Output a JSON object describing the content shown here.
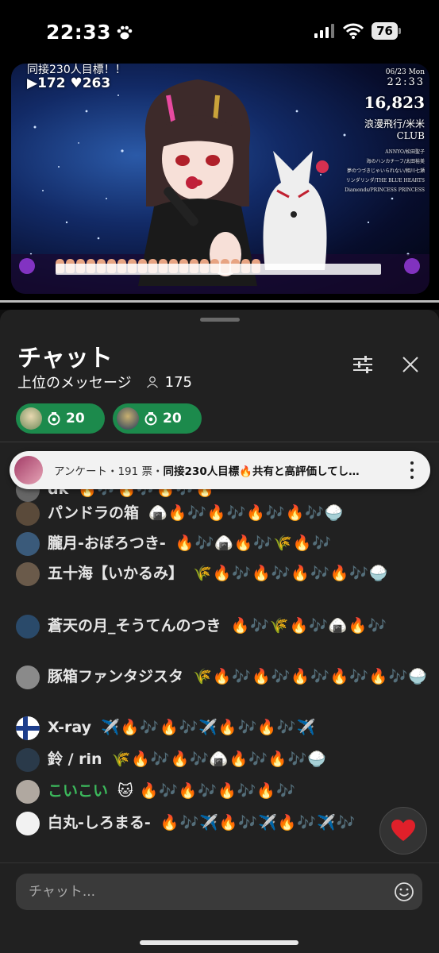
{
  "status_bar": {
    "time": "22:33",
    "battery": "76"
  },
  "video": {
    "overlay_goal": "同接230人目標！！",
    "overlay_views": "▶172",
    "overlay_likes": "♥263",
    "overlay_date": "06/23 Mon",
    "overlay_clock": "22:33",
    "overlay_count": "16,823",
    "overlay_song": "浪漫飛行/米米CLUB",
    "overlay_list": [
      "ANNYO/松田聖子",
      "海のハンカチーフ/太田裕美",
      "夢のつづきじゃいられない/相川七瀬",
      "リンダリンダ/THE BLUE HEARTS",
      "Diamonds/PRINCESS PRINCESS"
    ]
  },
  "chat": {
    "title": "チャット",
    "subtitle": "上位のメッセージ",
    "viewer_count": "175",
    "badges": [
      {
        "value": "20"
      },
      {
        "value": "20"
      }
    ],
    "poll": {
      "label": "アンケート・191 票・",
      "text": "同接230人目標🔥共有と高評価してし…"
    },
    "messages": [
      {
        "author": "dk",
        "text": "🔥🎶🔥🎶🔥🎶🔥",
        "avatar": "#666666"
      },
      {
        "author": "パンドラの箱",
        "text": "🍙🔥🎶🔥🎶🔥🎶🔥🎶🍚",
        "avatar": "#5a4a3a"
      },
      {
        "author": "朧月-おぼろつき-",
        "text": "🔥🎶🍙🔥🎶🌾🔥🎶",
        "avatar": "#3a5a7a"
      },
      {
        "author": "五十海【いかるみ】",
        "text": "🌾🔥🎶🔥🎶🔥🎶🔥🎶🍚",
        "avatar": "#6a5a4a"
      },
      {
        "author": "蒼天の月_そうてんのつき",
        "text": "🔥🎶🌾🔥🎶🍙🔥🎶",
        "avatar": "#2a4a6a"
      },
      {
        "author": "豚箱ファンタジスタ",
        "text": "🌾🔥🎶🔥🎶🔥🎶🔥🎶🔥🎶🍚",
        "avatar": "#8a8a8a"
      },
      {
        "author": "X-ray",
        "text": "✈️🔥🎶🔥🎶✈️🔥🎶🔥🎶✈️",
        "avatar": "#ffffff"
      },
      {
        "author": "鈴 / rin",
        "text": "🌾🔥🎶🔥🎶🍙🔥🎶🔥🎶🍚",
        "avatar": "#2a3a4a"
      },
      {
        "author": "こいこい",
        "text": "🔥🎶🔥🎶🔥🎶🔥🎶",
        "avatar": "#b0a8a0",
        "green": true,
        "sticker": "🐱"
      },
      {
        "author": "白丸-しろまる-",
        "text": "🔥🎶✈️🔥🎶✈️🔥🎶✈️🎶",
        "avatar": "#f2f2f2"
      }
    ],
    "input_placeholder": "チャット..."
  },
  "colors": {
    "badge_green": "#1c8a4c",
    "panel_bg": "#212121",
    "author_green": "#3cb95c",
    "heart_red": "#e0202a"
  }
}
